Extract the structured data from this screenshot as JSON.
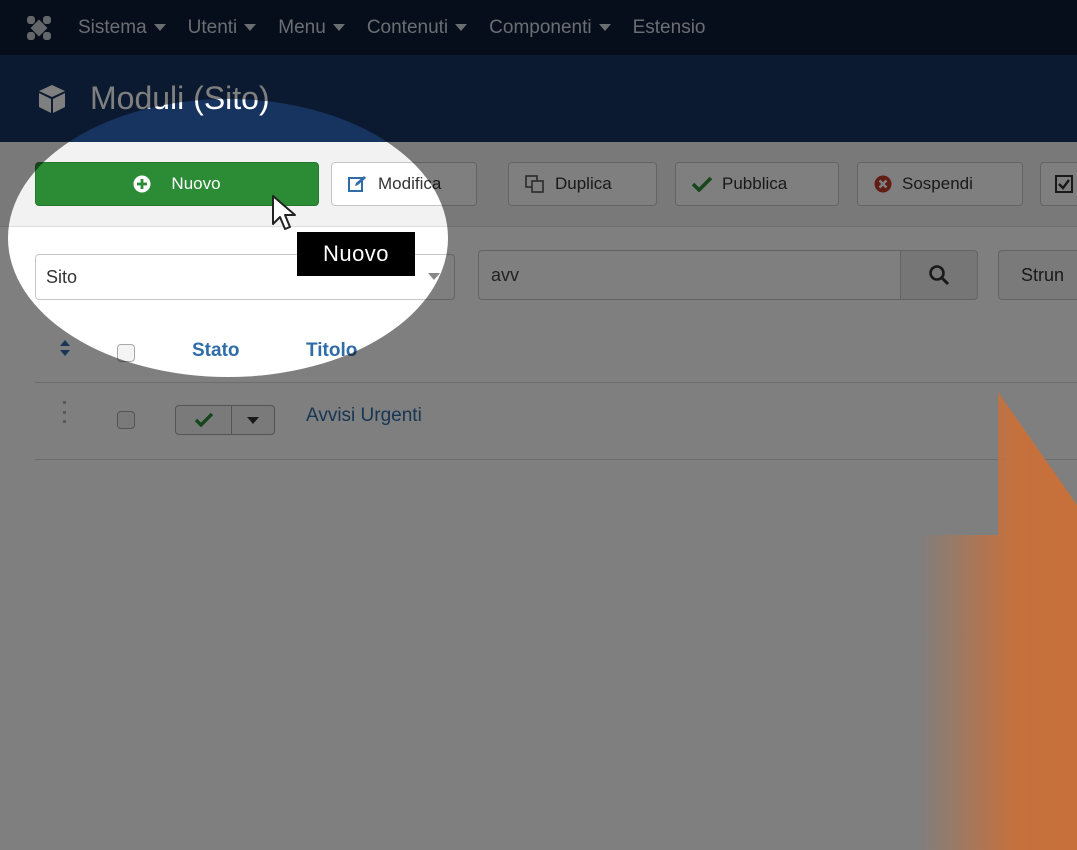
{
  "navbar": {
    "items": [
      {
        "label": "Sistema"
      },
      {
        "label": "Utenti"
      },
      {
        "label": "Menu"
      },
      {
        "label": "Contenuti"
      },
      {
        "label": "Componenti"
      },
      {
        "label": "Estensio"
      }
    ]
  },
  "header": {
    "title": "Moduli (Sito)",
    "icon": "cube-icon"
  },
  "toolbar": {
    "new_label": "Nuovo",
    "edit_label": "Modifica",
    "duplicate_label": "Duplica",
    "publish_label": "Pubblica",
    "unpublish_label": "Sospendi"
  },
  "filters": {
    "client_select_value": "Sito",
    "search_value": "avv",
    "tools_label": "Strun"
  },
  "table": {
    "columns": {
      "stato": "Stato",
      "titolo": "Titolo"
    },
    "rows": [
      {
        "title": "Avvisi Urgenti",
        "status": "published"
      }
    ]
  },
  "tooltip": {
    "text": "Nuovo"
  },
  "colors": {
    "navbar": "#0b1d35",
    "header": "#173460",
    "new_button": "#2c8c36",
    "link": "#2f6da7",
    "arrow": "#c8703a",
    "overlay": "rgba(0,0,0,0.5)"
  }
}
